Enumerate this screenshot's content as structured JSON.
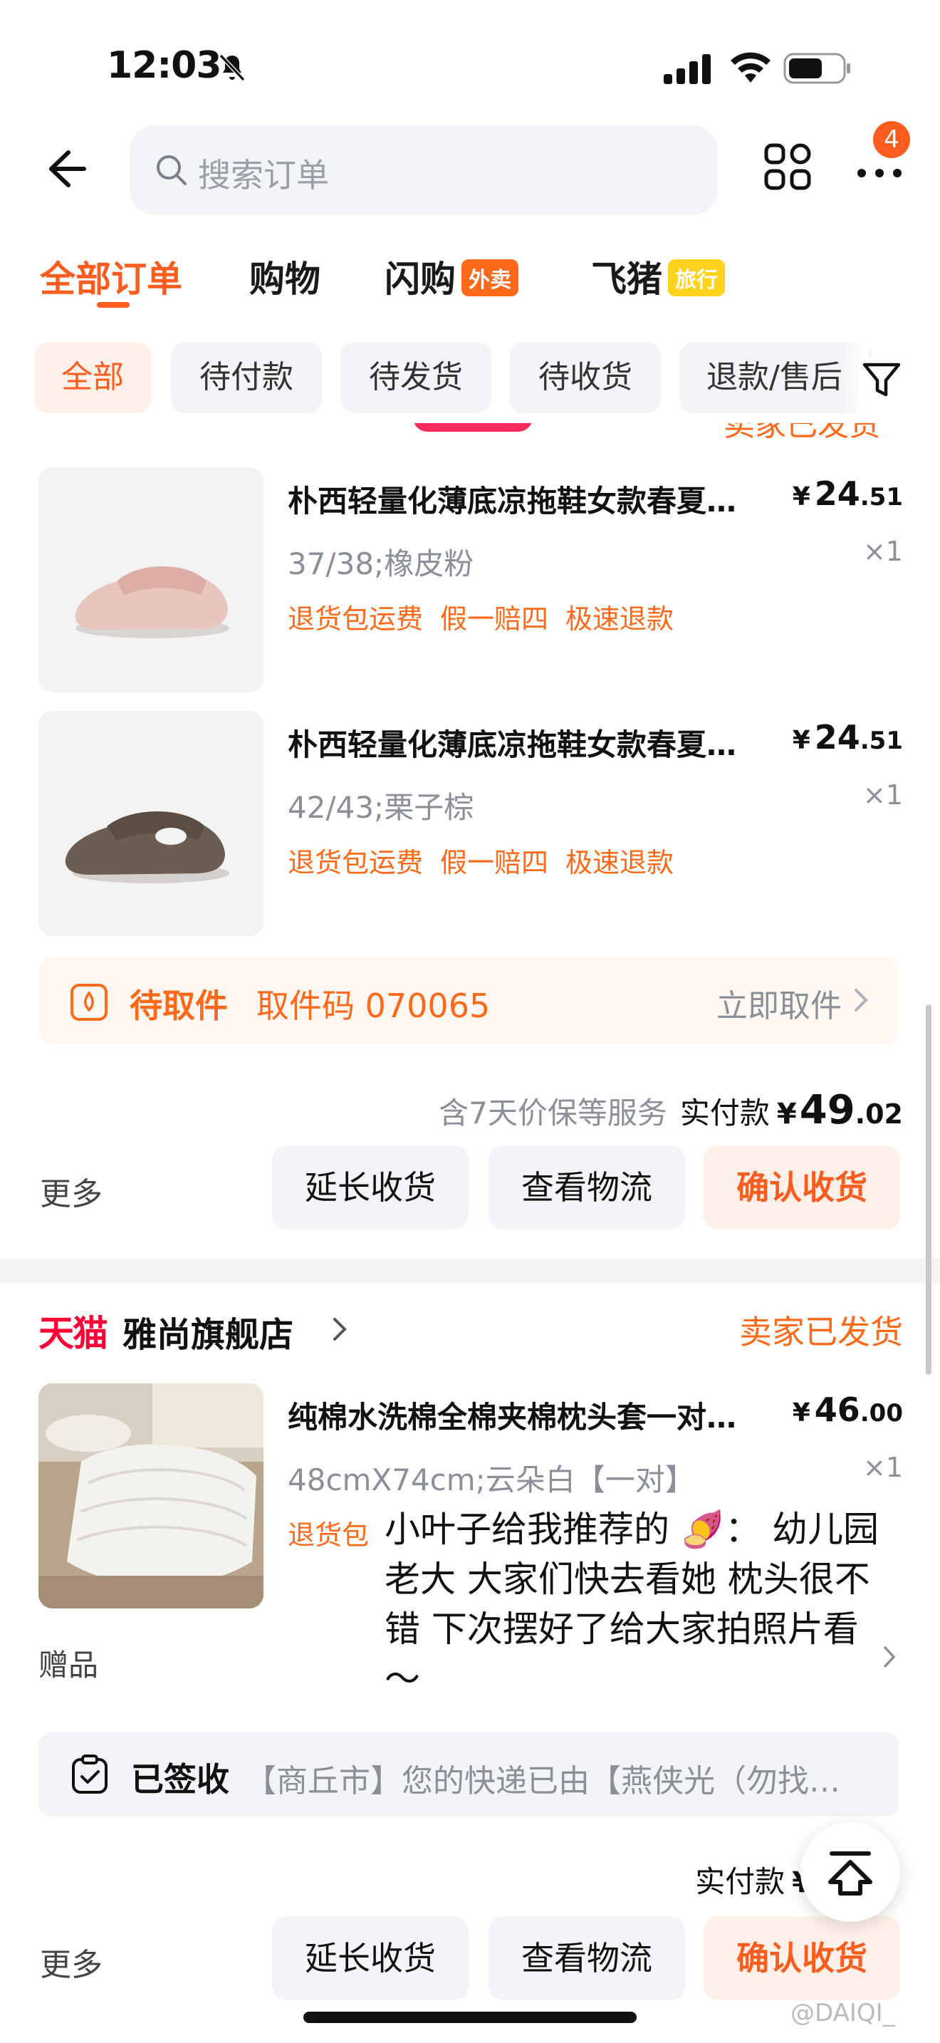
{
  "status_bar": {
    "time": "12:03"
  },
  "header": {
    "search_placeholder": "搜索订单",
    "badge_count": "4"
  },
  "tabs": [
    {
      "label": "全部订单",
      "active": true
    },
    {
      "label": "购物"
    },
    {
      "label": "闪购",
      "tag": "外卖"
    },
    {
      "label": "飞猪",
      "tag": "旅行"
    }
  ],
  "filters": [
    "全部",
    "待付款",
    "待发货",
    "待收货",
    "退款/售后"
  ],
  "order1": {
    "items": [
      {
        "title": "朴西轻量化薄底凉拖鞋女款春夏…",
        "price_main": "24",
        "price_dec": ".51",
        "sku": "37/38;橡皮粉",
        "qty": "×1",
        "badges": [
          "退货包运费",
          "假一赔四",
          "极速退款"
        ],
        "shoe_color": "#e9c6bd"
      },
      {
        "title": "朴西轻量化薄底凉拖鞋女款春夏…",
        "price_main": "24",
        "price_dec": ".51",
        "sku": "42/43;栗子棕",
        "qty": "×1",
        "badges": [
          "退货包运费",
          "假一赔四",
          "极速退款"
        ],
        "shoe_color": "#6b5d52"
      }
    ],
    "pickup": {
      "status": "待取件",
      "code": "取件码 070065",
      "action": "立即取件"
    },
    "pay": {
      "note": "含7天价保等服务",
      "label": "实付款",
      "yen": "¥",
      "main": "49",
      "dec": ".02"
    },
    "actions": {
      "more": "更多",
      "extend": "延长收货",
      "logistics": "查看物流",
      "confirm": "确认收货"
    }
  },
  "order2": {
    "brand": "天猫",
    "store": "雅尚旗舰店",
    "status": "卖家已发货",
    "item": {
      "title": "纯棉水洗棉全棉夹棉枕头套一对…",
      "price_main": "46",
      "price_dec": ".00",
      "sku": "48cmX74cm;云朵白【一对】",
      "qty": "×1",
      "badge": "退货包"
    },
    "gift": "赠品",
    "overlay": "小叶子给我推荐的 🍠： 幼儿园老大 大家们快去看她 枕头很不错 下次摆好了给大家拍照片看～",
    "signed": {
      "status": "已签收",
      "text": "【商丘市】您的快递已由【燕侠光（勿找…"
    },
    "pay": {
      "label": "实付款",
      "yen": "¥"
    },
    "actions": {
      "more": "更多",
      "extend": "延长收货",
      "logistics": "查看物流",
      "confirm": "确认收货"
    }
  },
  "cut_store": {
    "status": "卖家已发货"
  },
  "watermark": "@DAIQI_",
  "colors": {
    "accent": "#ff5d1f",
    "tmall": "#ff0036"
  }
}
